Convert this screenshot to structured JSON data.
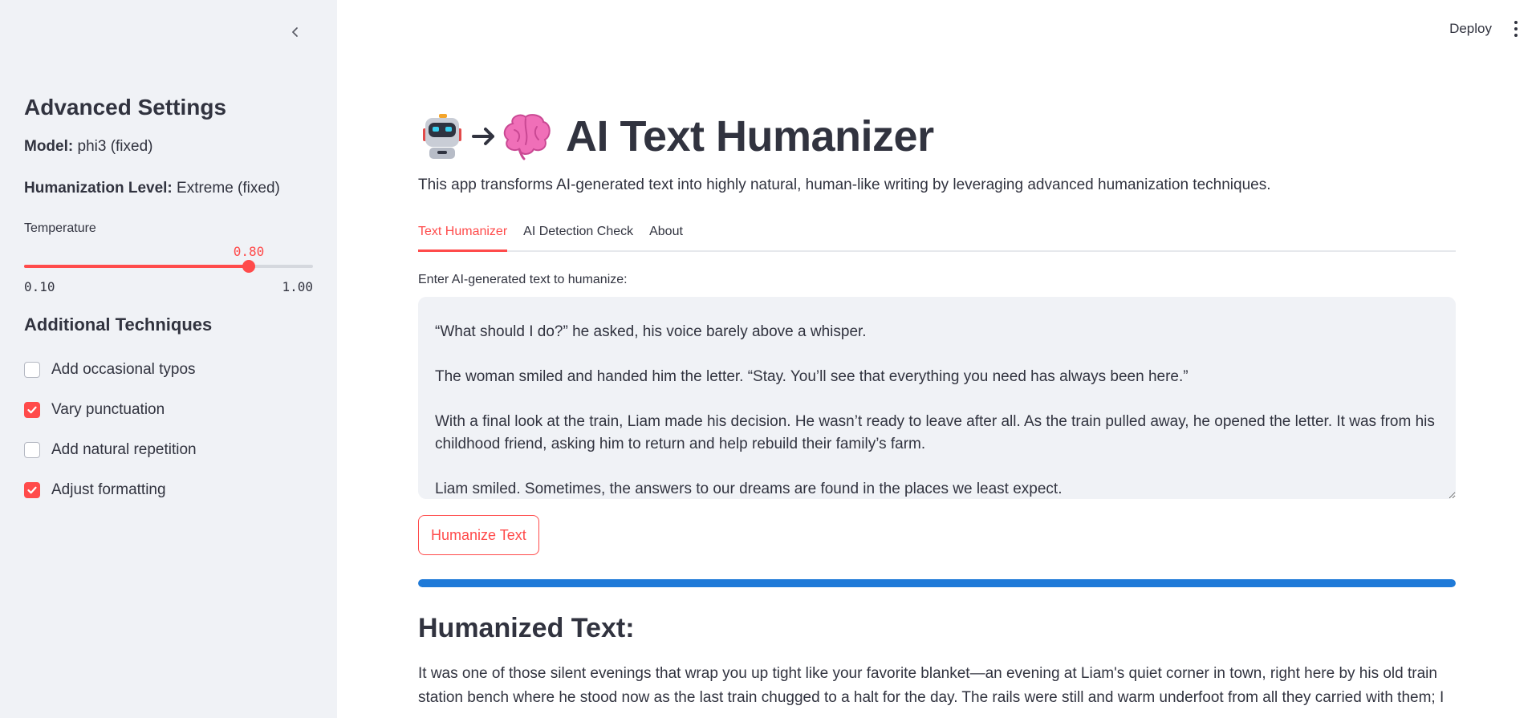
{
  "sidebar": {
    "title": "Advanced Settings",
    "model_label": "Model:",
    "model_value": " phi3 (fixed)",
    "level_label": "Humanization Level:",
    "level_value": " Extreme (fixed)",
    "temperature": {
      "label": "Temperature",
      "value": "0.80",
      "value_num": 0.8,
      "min": "0.10",
      "max": "1.00",
      "min_num": 0.1,
      "max_num": 1.0
    },
    "techniques_title": "Additional Techniques",
    "techniques": [
      {
        "label": "Add occasional typos",
        "checked": false
      },
      {
        "label": "Vary punctuation",
        "checked": true
      },
      {
        "label": "Add natural repetition",
        "checked": false
      },
      {
        "label": "Adjust formatting",
        "checked": true
      }
    ]
  },
  "topbar": {
    "deploy_label": "Deploy"
  },
  "main": {
    "title": "AI Text Humanizer",
    "description": "This app transforms AI-generated text into highly natural, human-like writing by leveraging advanced humanization techniques.",
    "tabs": [
      {
        "label": "Text Humanizer",
        "active": true
      },
      {
        "label": "AI Detection Check",
        "active": false
      },
      {
        "label": "About",
        "active": false
      }
    ],
    "input_label": "Enter AI-generated text to humanize:",
    "input_value": "“What should I do?” he asked, his voice barely above a whisper.\n\nThe woman smiled and handed him the letter. “Stay. You’ll see that everything you need has always been here.”\n\nWith a final look at the train, Liam made his decision. He wasn’t ready to leave after all. As the train pulled away, he opened the letter. It was from his childhood friend, asking him to return and help rebuild their family’s farm.\n\nLiam smiled. Sometimes, the answers to our dreams are found in the places we least expect.",
    "button_label": "Humanize Text",
    "progress": 1.0,
    "output_title": "Humanized Text:",
    "output_text": "It was one of those silent evenings that wrap you up tight like your favorite blanket—an evening at Liam's quiet corner in town, right here by his old train station bench where he stood now as the last train chugged to a halt for the day. The rails were still and warm underfoot from all they carried with them; I"
  },
  "colors": {
    "accent": "#ff4b4b",
    "progress": "#1f7ad8",
    "sidebar_bg": "#f0f2f6"
  }
}
